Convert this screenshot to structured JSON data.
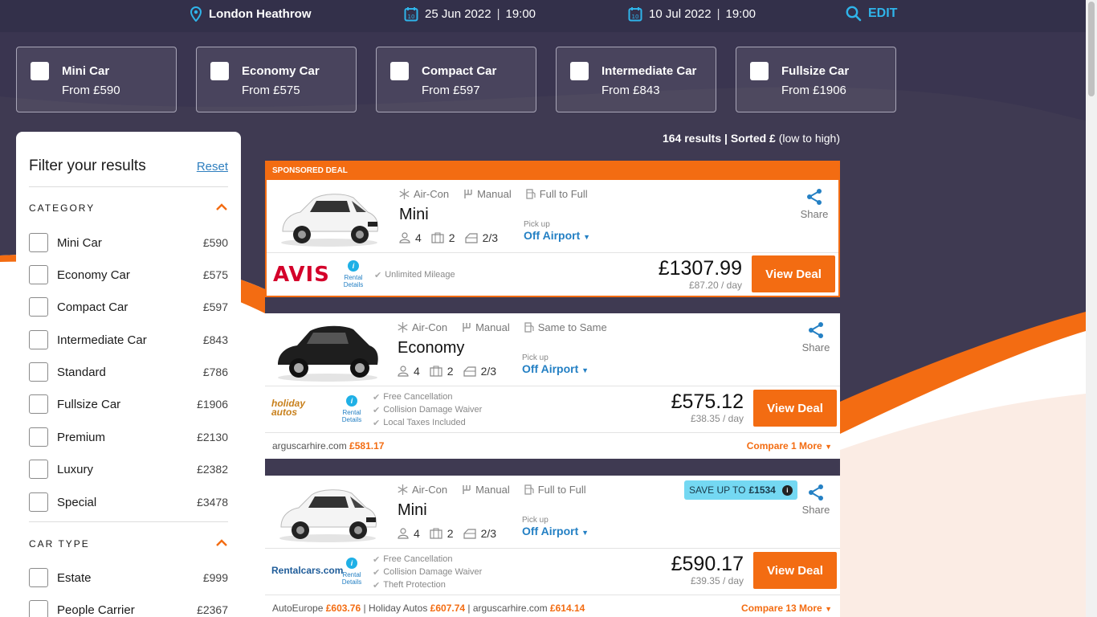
{
  "header": {
    "location": "London Heathrow",
    "pickup_date": "25 Jun 2022",
    "pickup_time": "19:00",
    "dropoff_date": "10 Jul 2022",
    "dropoff_time": "19:00",
    "edit_label": "EDIT"
  },
  "category_tiles": [
    {
      "name": "Mini Car",
      "from": "From £590"
    },
    {
      "name": "Economy Car",
      "from": "From £575"
    },
    {
      "name": "Compact Car",
      "from": "From £597"
    },
    {
      "name": "Intermediate Car",
      "from": "From £843"
    },
    {
      "name": "Fullsize Car",
      "from": "From £1906"
    }
  ],
  "results": {
    "count": "164 results | Sorted £",
    "sort": "(low to high)"
  },
  "filter": {
    "title": "Filter your results",
    "reset": "Reset",
    "category_heading": "CATEGORY",
    "categories": [
      {
        "label": "Mini Car",
        "price": "£590"
      },
      {
        "label": "Economy Car",
        "price": "£575"
      },
      {
        "label": "Compact Car",
        "price": "£597"
      },
      {
        "label": "Intermediate Car",
        "price": "£843"
      },
      {
        "label": "Standard",
        "price": "£786"
      },
      {
        "label": "Fullsize Car",
        "price": "£1906"
      },
      {
        "label": "Premium",
        "price": "£2130"
      },
      {
        "label": "Luxury",
        "price": "£2382"
      },
      {
        "label": "Special",
        "price": "£3478"
      }
    ],
    "cartype_heading": "CAR TYPE",
    "car_types": [
      {
        "label": "Estate",
        "price": "£999"
      },
      {
        "label": "People Carrier",
        "price": "£2367"
      }
    ]
  },
  "sponsored_label": "SPONSORED DEAL",
  "common": {
    "aircon": "Air-Con",
    "manual": "Manual",
    "seats": "4",
    "bags": "2",
    "doors": "2/3",
    "pickup_label": "Pick up",
    "pickup_value": "Off Airport",
    "share": "Share",
    "rental_details": "Rental Details",
    "view_deal": "View Deal"
  },
  "deals": [
    {
      "fuel": "Full to Full",
      "car_class": "Mini",
      "supplier": "AVIS",
      "inclusions": [
        "Unlimited Mileage"
      ],
      "price": "£1307.99",
      "per_day": "£87.20 / day"
    },
    {
      "fuel": "Same to Same",
      "car_class": "Economy",
      "supplier": "holiday autos",
      "inclusions": [
        "Free Cancellation",
        "Collision Damage Waiver",
        "Local Taxes Included"
      ],
      "price": "£575.12",
      "per_day": "£38.35 / day",
      "compare": [
        {
          "name": "arguscarhire.com",
          "price": "£581.17"
        }
      ],
      "compare_more": "Compare 1 More"
    },
    {
      "fuel": "Full to Full",
      "car_class": "Mini",
      "supplier": "Rentalcars.com",
      "inclusions": [
        "Free Cancellation",
        "Collision Damage Waiver",
        "Theft Protection"
      ],
      "price": "£590.17",
      "per_day": "£39.35 / day",
      "save_label": "SAVE UP TO",
      "save_amount": "£1534",
      "compare": [
        {
          "name": "AutoEurope",
          "price": "£603.76"
        },
        {
          "name": "Holiday Autos",
          "price": "£607.74"
        },
        {
          "name": "arguscarhire.com",
          "price": "£614.14"
        }
      ],
      "compare_more": "Compare 13 More"
    }
  ],
  "colors": {
    "accent": "#f36c12",
    "link": "#2480c4",
    "header_bg": "#33304a",
    "page_bg": "#3f3a52"
  }
}
